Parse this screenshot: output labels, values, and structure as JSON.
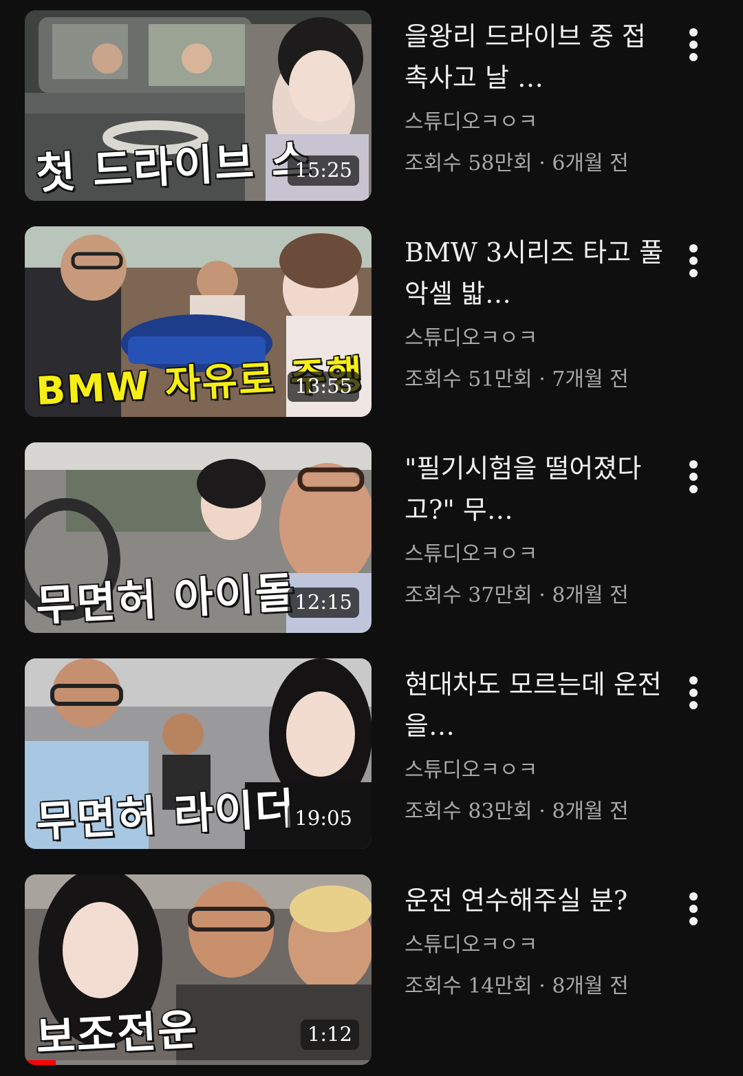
{
  "videos": [
    {
      "title": "을왕리 드라이브 중 접촉사고 날 …",
      "channel": "스튜디오ㅋㅇㅋ",
      "views": "조회수 58만회",
      "age": "6개월 전",
      "duration": "15:25",
      "thumb_text": "첫 드라이브 스",
      "thumb_text_color": "#ffffff",
      "thumb_bg": "#5b5e5c"
    },
    {
      "title": "BMW 3시리즈 타고 풀악셀 밟…",
      "channel": "스튜디오ㅋㅇㅋ",
      "views": "조회수 51만회",
      "age": "7개월 전",
      "duration": "13:55",
      "thumb_text": "BMW 자유로 주행",
      "thumb_text_color": "#f7ef14",
      "thumb_bg": "#6c5a4a"
    },
    {
      "title": "\"필기시험을 떨어졌다고?\" 무…",
      "channel": "스튜디오ㅋㅇㅋ",
      "views": "조회수 37만회",
      "age": "8개월 전",
      "duration": "12:15",
      "thumb_text": "무면허 아이돌",
      "thumb_text_color": "#ffffff",
      "thumb_bg": "#7c7a76"
    },
    {
      "title": "현대차도 모르는데 운전을…",
      "channel": "스튜디오ㅋㅇㅋ",
      "views": "조회수 83만회",
      "age": "8개월 전",
      "duration": "19:05",
      "thumb_text": "무면허 라이더",
      "thumb_text_color": "#ffffff",
      "thumb_bg": "#8a8a8c"
    },
    {
      "title": "운전 연수해주실 분?",
      "channel": "스튜디오ㅋㅇㅋ",
      "views": "조회수 14만회",
      "age": "8개월 전",
      "duration": "1:12",
      "thumb_text": "보조전운",
      "thumb_text_color": "#ffffff",
      "thumb_bg": "#6e6864",
      "watch_progress": 0.09
    }
  ],
  "meta_separator": " · ",
  "colors": {
    "background": "#0f0f0f",
    "title": "#f1f1f1",
    "secondary": "#a9a9a9",
    "progress": "#ff0000"
  }
}
